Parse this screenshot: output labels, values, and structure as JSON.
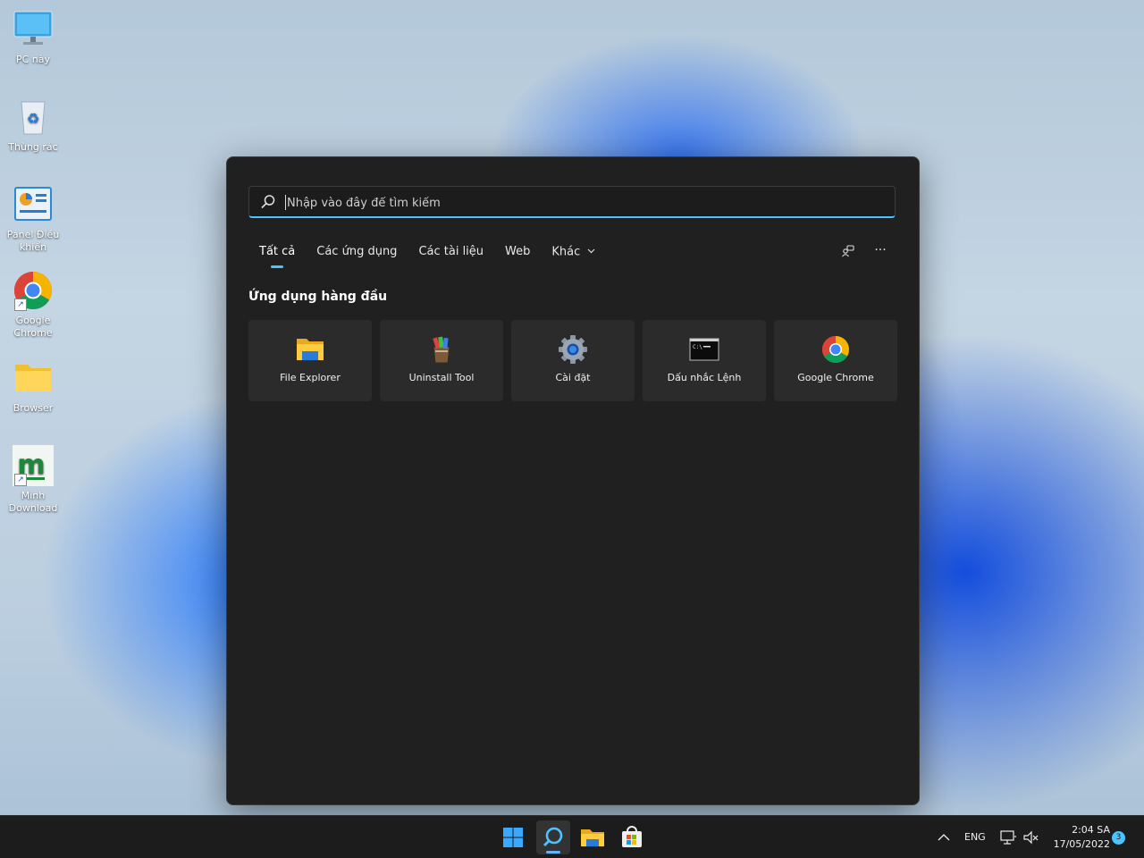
{
  "desktop": {
    "icons": [
      {
        "label": "PC này"
      },
      {
        "label": "Thùng rác"
      },
      {
        "label": "Panel Điều khiển"
      },
      {
        "label": "Google Chrome"
      },
      {
        "label": "Browser"
      },
      {
        "label": "Minh Download"
      }
    ]
  },
  "search": {
    "placeholder": "Nhập vào đây để tìm kiếm",
    "value": "",
    "tabs": [
      {
        "label": "Tất cả"
      },
      {
        "label": "Các ứng dụng"
      },
      {
        "label": "Các tài liệu"
      },
      {
        "label": "Web"
      },
      {
        "label": "Khác"
      }
    ],
    "more_button": "···",
    "section_title": "Ứng dụng hàng đầu",
    "top_apps": [
      {
        "label": "File Explorer",
        "icon": "folder-icon"
      },
      {
        "label": "Uninstall Tool",
        "icon": "uninstall-tool-icon"
      },
      {
        "label": "Cài đặt",
        "icon": "gear-icon"
      },
      {
        "label": "Dấu nhắc Lệnh",
        "icon": "terminal-icon"
      },
      {
        "label": "Google Chrome",
        "icon": "chrome-icon"
      }
    ]
  },
  "taskbar": {
    "language": "ENG",
    "time": "2:04 SA",
    "date": "17/05/2022",
    "notification_count": "3"
  },
  "colors": {
    "accent": "#4cc2ff",
    "panel_bg": "#202020",
    "tile_bg": "#2b2b2b",
    "taskbar_bg": "#1c1c1c"
  }
}
